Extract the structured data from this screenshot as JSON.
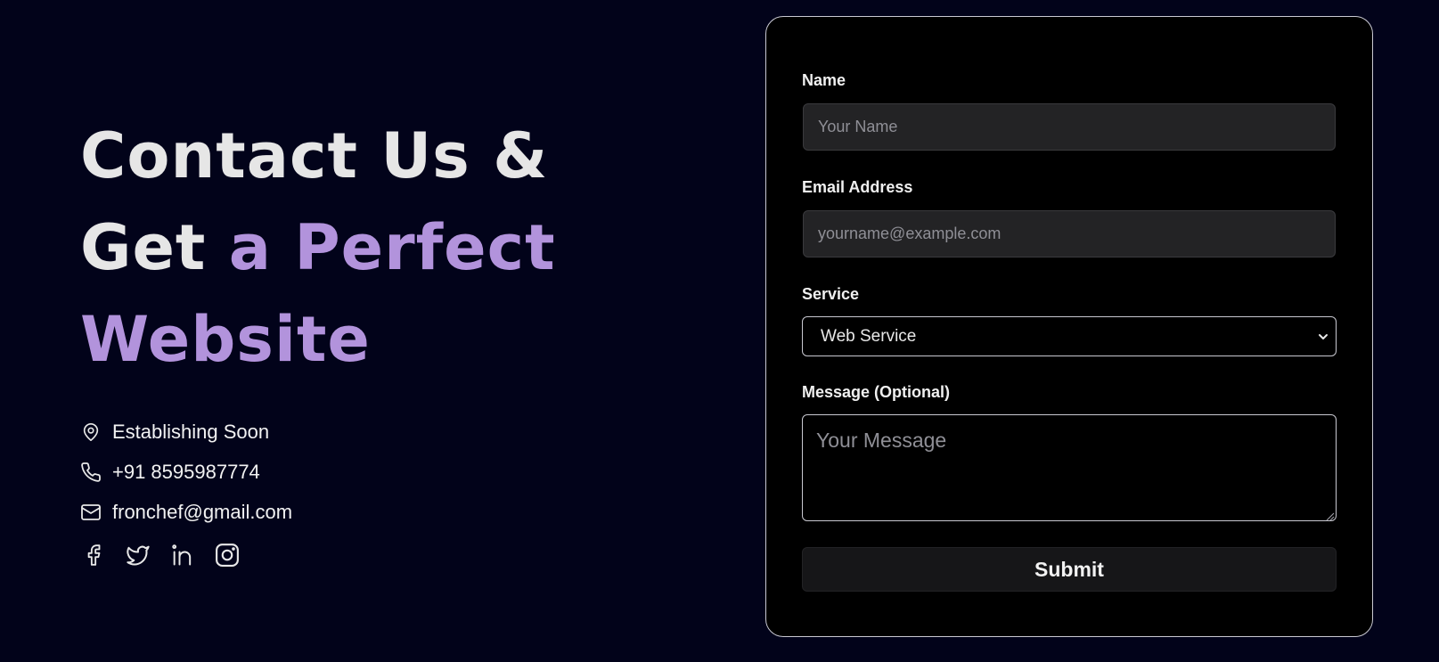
{
  "hero": {
    "line1": "Contact Us &",
    "line2_plain": "Get ",
    "line2_accent": "a Perfect",
    "line3_accent": "Website"
  },
  "contact": {
    "location": {
      "icon": "map-pin-icon",
      "text": "Establishing Soon"
    },
    "phone": {
      "icon": "phone-icon",
      "text": "+91 8595987774"
    },
    "email": {
      "icon": "mail-icon",
      "text": "fronchef@gmail.com"
    }
  },
  "socials": [
    {
      "icon": "facebook-icon"
    },
    {
      "icon": "twitter-icon"
    },
    {
      "icon": "linkedin-icon"
    },
    {
      "icon": "instagram-icon"
    }
  ],
  "form": {
    "name": {
      "label": "Name",
      "placeholder": "Your Name",
      "value": ""
    },
    "email": {
      "label": "Email Address",
      "placeholder": "yourname@example.com",
      "value": ""
    },
    "service": {
      "label": "Service",
      "selected": "Web Service"
    },
    "message": {
      "label": "Message (Optional)",
      "placeholder": "Your Message",
      "value": ""
    },
    "submit_label": "Submit"
  },
  "colors": {
    "background": "#02031a",
    "accent": "#b293dc",
    "card": "#000000",
    "input_bg": "#232325",
    "text": "#e6e6e6"
  }
}
